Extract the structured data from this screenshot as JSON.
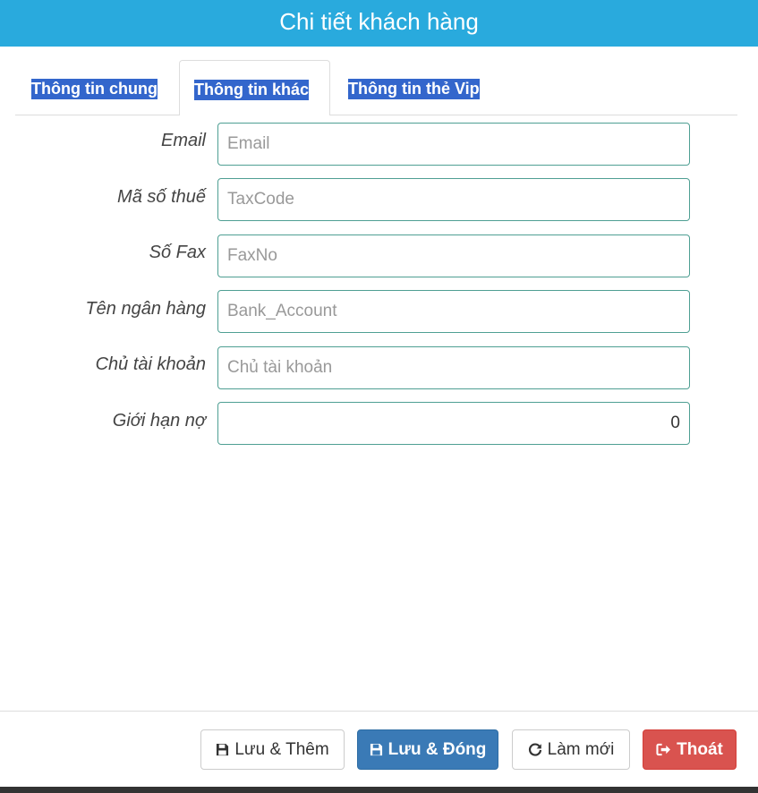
{
  "header": {
    "title": "Chi tiết khách hàng"
  },
  "tabs": [
    {
      "label": "Thông tin chung"
    },
    {
      "label": "Thông tin khác"
    },
    {
      "label": "Thông tin thẻ Vip"
    }
  ],
  "form": {
    "fields": [
      {
        "label": "Email",
        "placeholder": "Email",
        "value": ""
      },
      {
        "label": "Mã số thuế",
        "placeholder": "TaxCode",
        "value": ""
      },
      {
        "label": "Số Fax",
        "placeholder": "FaxNo",
        "value": ""
      },
      {
        "label": "Tên ngân hàng",
        "placeholder": "Bank_Account",
        "value": ""
      },
      {
        "label": "Chủ tài khoản",
        "placeholder": "Chủ tài khoản",
        "value": ""
      },
      {
        "label": "Giới hạn nợ",
        "placeholder": "",
        "value": "0"
      }
    ]
  },
  "buttons": {
    "save_new": "Lưu & Thêm",
    "save_close": "Lưu & Đóng",
    "refresh": "Làm mới",
    "exit": "Thoát"
  },
  "colors": {
    "header": "#29aadd",
    "tab_highlight": "#3366cc",
    "field_border": "#4f9f93",
    "primary": "#3a7ab6",
    "danger": "#d9534f"
  },
  "icons": {
    "save": "floppy-disk-icon",
    "refresh": "refresh-icon",
    "exit": "sign-out-icon"
  }
}
